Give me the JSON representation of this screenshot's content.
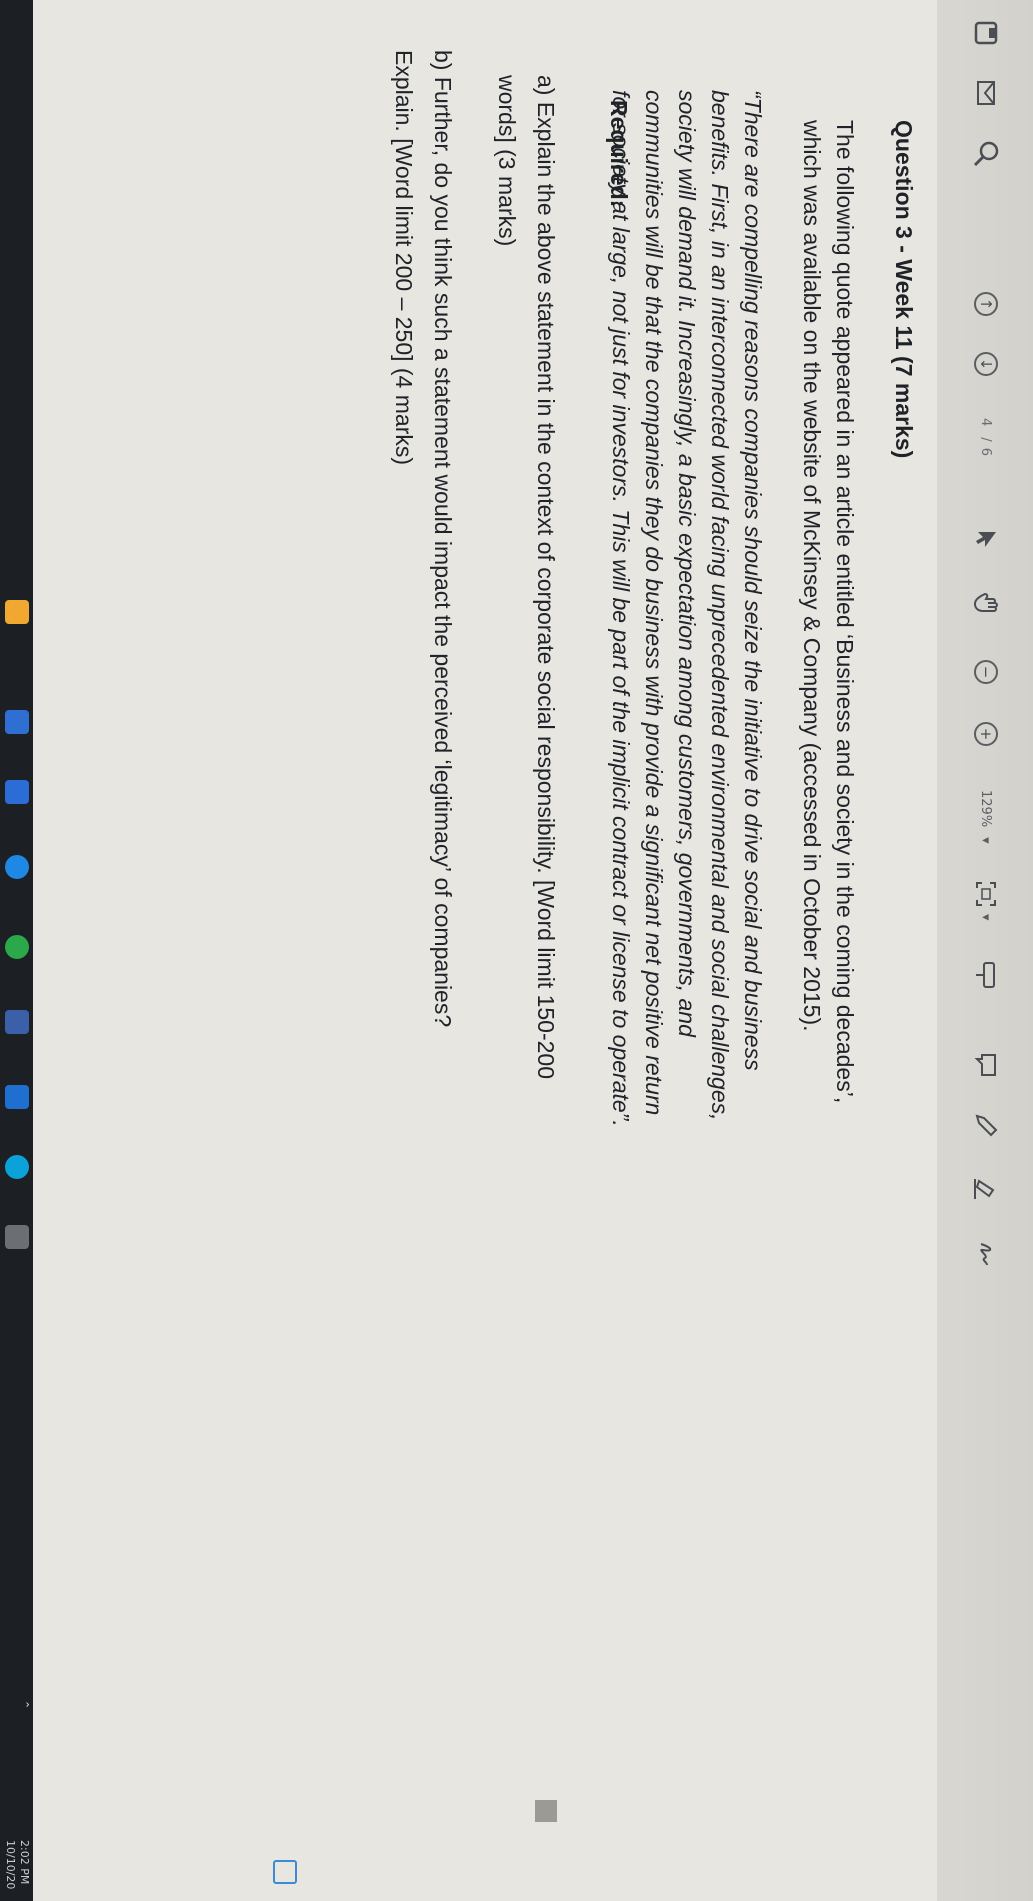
{
  "toolbar": {
    "page_current": "4",
    "page_total": "/ 6",
    "zoom": "129%",
    "zoom_caret": "▾",
    "fit_caret": "▾"
  },
  "document": {
    "title": "Question 3 - Week 11 (7 marks)",
    "intro_line1": "The following quote appeared in an article entitled ‘Business and society in the coming decades’,",
    "intro_line2": "which was available on the website of McKinsey & Company (accessed in October 2015).",
    "quote_line1": "“There are compelling reasons companies should seize the initiative to drive social and business",
    "quote_line2": "benefits. First, in an interconnected world facing unprecedented environmental and social challenges,",
    "quote_line3": "society will demand it. Increasingly, a basic expectation among customers, governments, and",
    "quote_line4": "communities will be that the companies they do business with provide a significant net positive return",
    "quote_line5": "for society at large, not just for investors. This will be part of the implicit contract or license to operate”.",
    "required_label": "Required:",
    "a_line1": "a) Explain the above statement in the context of corporate social responsibility. [Word limit 150-200",
    "a_line2": "words] (3 marks)",
    "b_line1": "b) Further, do you think such a statement would impact the perceived ‘legitimacy’ of companies?",
    "b_line2": "Explain. [Word limit 200 – 250] (4 marks)"
  },
  "taskbar": {
    "time": "2:02 PM",
    "date": "10/10/20"
  },
  "colors": {
    "accent_blue": "#2b6cd6",
    "edge_blue": "#1e88e5",
    "edge_green": "#2aa84a"
  }
}
